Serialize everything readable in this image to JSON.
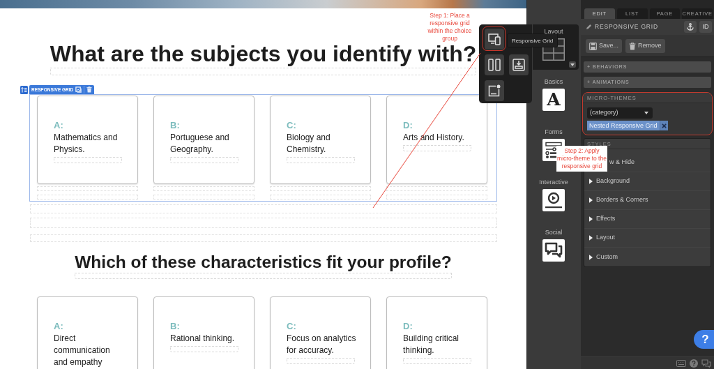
{
  "canvas": {
    "sections": [
      {
        "heading": "What are the subjects you identify with?",
        "grid_selected": true,
        "grid_label": "RESPONSIVE GRID",
        "cards": [
          {
            "letter": "A:",
            "text": "Mathematics and Physics."
          },
          {
            "letter": "B:",
            "text": "Portuguese and Geography."
          },
          {
            "letter": "C:",
            "text": "Biology and Chemistry."
          },
          {
            "letter": "D:",
            "text": "Arts and History."
          }
        ]
      },
      {
        "heading": "Which of these characteristics fit your profile?",
        "grid_selected": false,
        "cards": [
          {
            "letter": "A:",
            "text": "Direct communication and empathy"
          },
          {
            "letter": "B:",
            "text": "Rational thinking."
          },
          {
            "letter": "C:",
            "text": "Focus on analytics for accuracy."
          },
          {
            "letter": "D:",
            "text": "Building critical thinking."
          }
        ]
      }
    ]
  },
  "widget_bar": {
    "categories": [
      {
        "label": "Layout",
        "kind": "layout",
        "selected": true
      },
      {
        "label": "Basics",
        "kind": "basics",
        "glyph": "A",
        "selected": false
      },
      {
        "label": "Forms",
        "kind": "forms",
        "selected": false
      },
      {
        "label": "Interactive",
        "kind": "interactive",
        "selected": false
      },
      {
        "label": "Social",
        "kind": "social",
        "selected": false
      }
    ],
    "flyout": {
      "items": [
        {
          "kind": "responsive-grid",
          "highlighted": true
        },
        {
          "kind": "columns",
          "highlighted": false
        },
        {
          "kind": "insert",
          "highlighted": false
        },
        {
          "kind": "frame",
          "highlighted": false
        }
      ],
      "tooltip": "Responsive Grid"
    }
  },
  "inspector": {
    "tabs": [
      {
        "label": "EDIT",
        "selected": true
      },
      {
        "label": "LIST",
        "selected": false
      },
      {
        "label": "PAGE",
        "selected": false
      },
      {
        "label": "CREATIVE",
        "selected": false
      }
    ],
    "title": "RESPONSIVE GRID",
    "id_button": "ID",
    "actions": [
      {
        "kind": "save",
        "label": "Save..."
      },
      {
        "kind": "remove",
        "label": "Remove"
      }
    ],
    "sections": [
      "+ BEHAVIORS",
      "+ ANIMATIONS"
    ],
    "micro_themes": {
      "title": "MICRO-THEMES",
      "highlighted": true,
      "category": "(category)",
      "tags": [
        "Nested Responsive Grid"
      ]
    },
    "styles": {
      "title": "STYLES",
      "items": [
        {
          "label": "w & Hide",
          "caret": false
        },
        {
          "label": "Background",
          "caret": true
        },
        {
          "label": "Borders & Corners",
          "caret": true
        },
        {
          "label": "Effects",
          "caret": true
        },
        {
          "label": "Layout",
          "caret": true
        },
        {
          "label": "Custom",
          "caret": true
        }
      ]
    }
  },
  "help_button": "?",
  "annotations": [
    {
      "text": "Step 1: Place a responsive grid within the choice group"
    },
    {
      "text": "Step 2: Apply micro-theme to the responsive grid"
    }
  ]
}
